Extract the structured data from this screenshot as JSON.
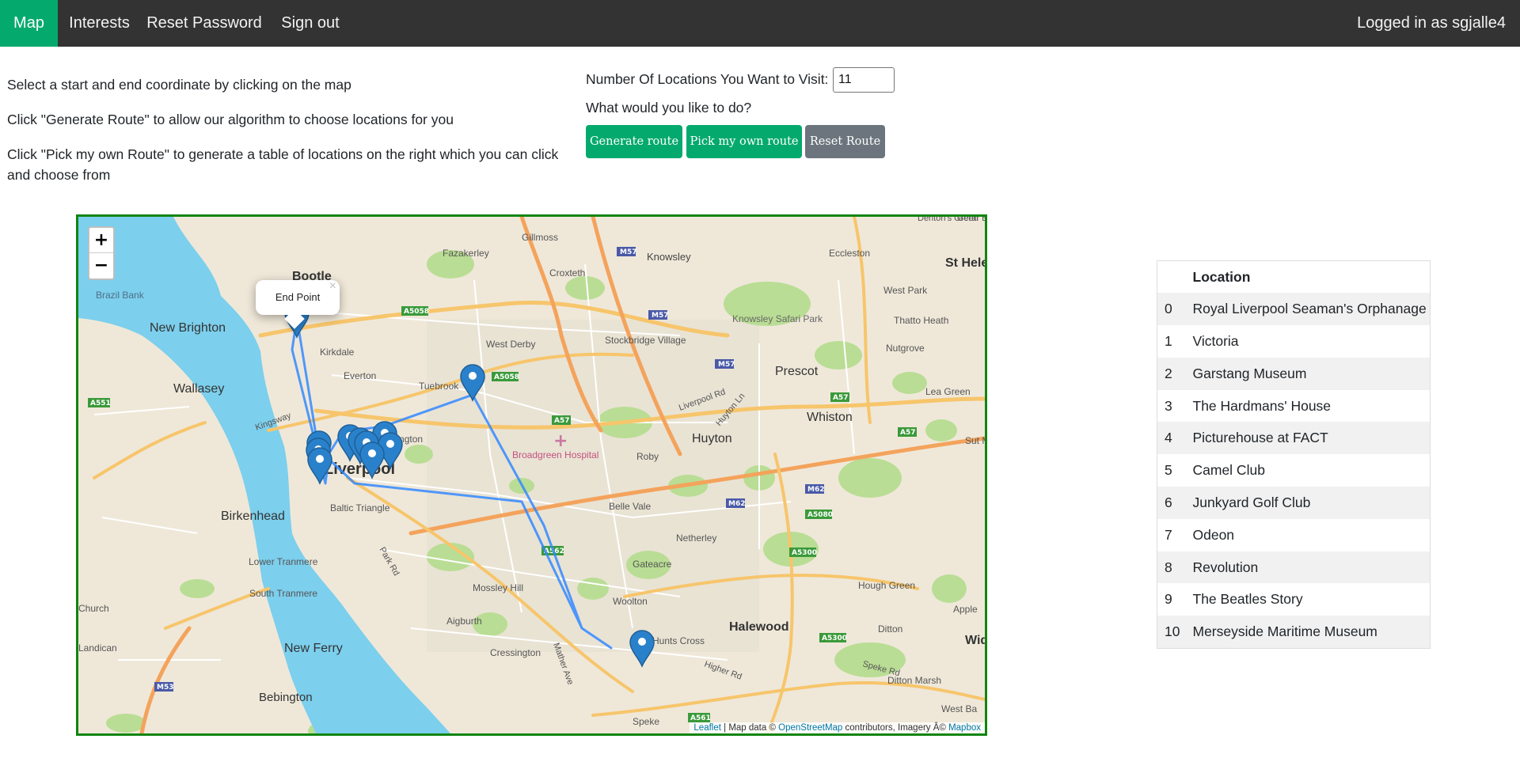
{
  "nav": {
    "items": [
      {
        "label": "Map",
        "active": true
      },
      {
        "label": "Interests",
        "active": false
      },
      {
        "label": "Reset Password",
        "active": false
      },
      {
        "label": "Sign out",
        "active": false
      }
    ],
    "user_text": "Logged in as sgjalle4"
  },
  "instructions": {
    "line1": "Select a start and end coordinate by clicking on the map",
    "line2": "Click \"Generate Route\" to allow our algorithm to choose locations for you",
    "line3a": "Click \"Pick my own Route\" to generate a table of locations on the right which you can click",
    "line3b": "and choose from"
  },
  "controls": {
    "num_label": "Number Of Locations You Want to Visit:",
    "num_value": "11",
    "question": "What would you like to do?",
    "generate_label": "Generate route",
    "pick_label": "Pick my own route",
    "reset_label": "Reset Route"
  },
  "map": {
    "zoom_in": "+",
    "zoom_out": "−",
    "popup_text": "End Point",
    "popup_close": "×",
    "attribution": {
      "leaflet": "Leaflet",
      "sep1": " | Map data © ",
      "osm": "OpenStreetMap",
      "sep2": " contributors, Imagery Â© ",
      "mapbox": "Mapbox"
    },
    "place_labels": [
      "Bootle",
      "Brazil Bank",
      "New Brighton",
      "Wallasey",
      "Birkenhead",
      "Kirkdale",
      "Everton",
      "Fazakerley",
      "Gillmoss",
      "Croxteth",
      "Knowsley",
      "West Derby",
      "Stockbridge Village",
      "Eccleston",
      "St Hele",
      "West Park",
      "Knowsley Safari Park",
      "Thatto Heath",
      "Nutgrove",
      "Prescot",
      "Lea Green",
      "Whiston",
      "Huyton",
      "Roby",
      "Broadgreen Hospital",
      "Tuebrook",
      "Kensington",
      "Baltic Triangle",
      "Belle Vale",
      "Netherley",
      "Gateacre",
      "Woolton",
      "Mossley Hill",
      "Aigburth",
      "Cressington",
      "Halewood",
      "Hough Green",
      "Ditton",
      "Ditton Marsh",
      "Hunts Cross",
      "Speke",
      "New Ferry",
      "Bebington",
      "Lower Tranmere",
      "South Tranmere",
      "Landican",
      "Church",
      "Apple",
      "Wid",
      "West Ba",
      "Liverpool",
      "Liverpool Rd",
      "Huyton Ln",
      "Mather Ave",
      "Park Rd",
      "Higher Rd",
      "Speke Rd",
      "Kingsway",
      "Denton's Green",
      "Gerar Brid",
      "Sut Ma"
    ],
    "road_labels": [
      "M57",
      "M57",
      "M57",
      "A5058",
      "A5058",
      "A57",
      "A57",
      "A57",
      "M62",
      "M62",
      "A5080",
      "A5300",
      "A5300",
      "A562",
      "A561",
      "A551",
      "M53"
    ]
  },
  "table": {
    "header": "Location",
    "rows": [
      {
        "index": "0",
        "name": "Royal Liverpool Seaman's Orphanage"
      },
      {
        "index": "1",
        "name": "Victoria"
      },
      {
        "index": "2",
        "name": "Garstang Museum"
      },
      {
        "index": "3",
        "name": "The Hardmans' House"
      },
      {
        "index": "4",
        "name": "Picturehouse at FACT"
      },
      {
        "index": "5",
        "name": "Camel Club"
      },
      {
        "index": "6",
        "name": "Junkyard Golf Club"
      },
      {
        "index": "7",
        "name": "Odeon"
      },
      {
        "index": "8",
        "name": "Revolution"
      },
      {
        "index": "9",
        "name": "The Beatles Story"
      },
      {
        "index": "10",
        "name": "Merseyside Maritime Museum"
      }
    ]
  },
  "colors": {
    "nav_bg": "#333333",
    "accent_green": "#04aa6d",
    "reset_grey": "#6c757d",
    "map_border": "#118511",
    "route_blue": "#3388ff",
    "marker_blue": "#2a81cb",
    "water": "#7ccfed",
    "land": "#efe8d9"
  }
}
